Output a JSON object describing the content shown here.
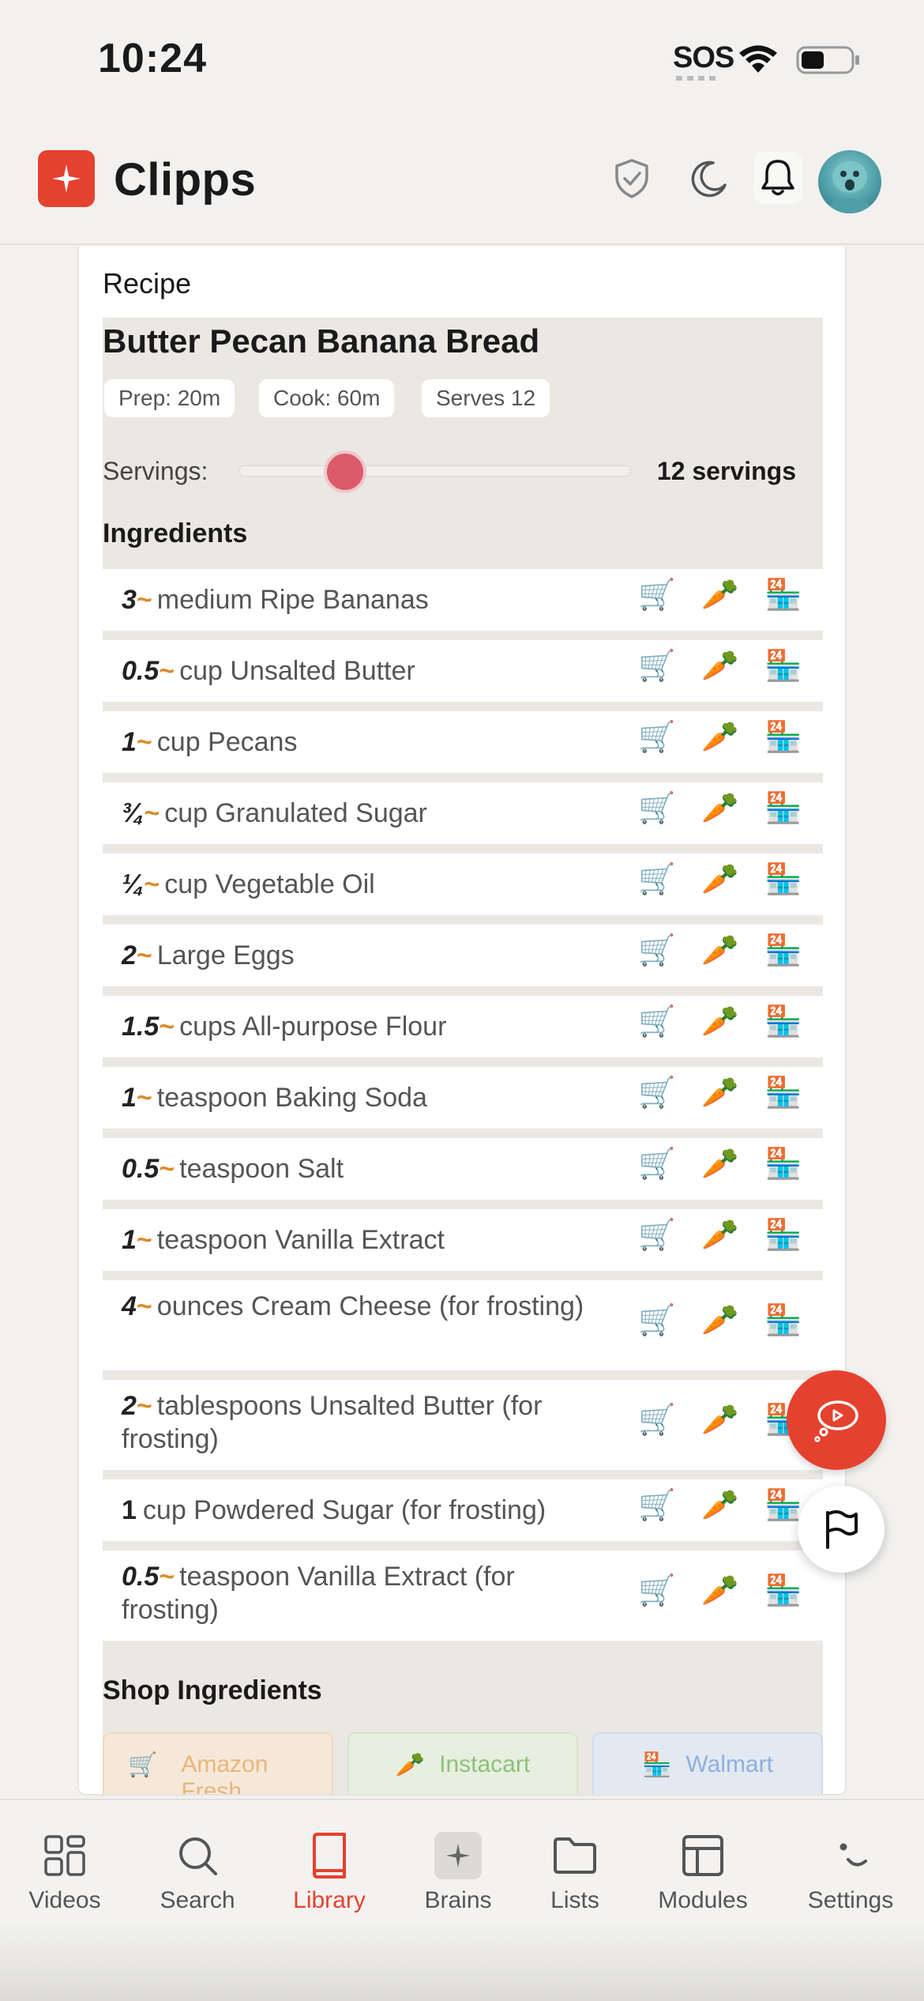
{
  "status_bar": {
    "time": "10:24",
    "sos": "SOS"
  },
  "header": {
    "app_name": "Clipps"
  },
  "recipe": {
    "section_label": "Recipe",
    "title": "Butter Pecan Banana Bread",
    "chips": {
      "prep": "Prep: 20m",
      "cook": "Cook: 60m",
      "serves": "Serves 12"
    },
    "servings_label": "Servings:",
    "servings_value": "12 servings",
    "servings_slider_fraction": 0.27,
    "ingredients_heading": "Ingredients",
    "ingredients": [
      {
        "qty": "3",
        "approx": "~",
        "text": "medium Ripe Bananas"
      },
      {
        "qty": "0.5",
        "approx": "~",
        "text": "cup Unsalted Butter"
      },
      {
        "qty": "1",
        "approx": "~",
        "text": "cup Pecans"
      },
      {
        "qty": "¾",
        "approx": "~",
        "text": "cup Granulated Sugar"
      },
      {
        "qty": "¼",
        "approx": "~",
        "text": "cup Vegetable Oil"
      },
      {
        "qty": "2",
        "approx": "~",
        "text": "Large Eggs"
      },
      {
        "qty": "1.5",
        "approx": "~",
        "text": "cups All-purpose Flour"
      },
      {
        "qty": "1",
        "approx": "~",
        "text": "teaspoon Baking Soda"
      },
      {
        "qty": "0.5",
        "approx": "~",
        "text": "teaspoon Salt"
      },
      {
        "qty": "1",
        "approx": "~",
        "text": "teaspoon Vanilla Extract"
      },
      {
        "qty": "4",
        "approx": "~",
        "text": "ounces Cream Cheese (for frosting)"
      },
      {
        "qty": "2",
        "approx": "~",
        "text": "tablespoons Unsalted Butter (for frosting)"
      },
      {
        "qty": "1",
        "approx": "",
        "text": "cup Powdered Sugar (for frosting)"
      },
      {
        "qty": "0.5",
        "approx": "~",
        "text": "teaspoon Vanilla Extract (for frosting)"
      }
    ],
    "row_icons": {
      "cart": "🛒",
      "carrot": "🥕",
      "store": "🏪"
    },
    "shop": {
      "heading": "Shop Ingredients",
      "amazon": "Amazon Fresh",
      "instacart": "Instacart",
      "walmart": "Walmart"
    }
  },
  "nav": {
    "items": [
      {
        "label": "Videos",
        "icon": "grid-icon"
      },
      {
        "label": "Search",
        "icon": "search-icon"
      },
      {
        "label": "Library",
        "icon": "book-icon",
        "active": true
      },
      {
        "label": "Brains",
        "icon": "sparkle-icon"
      },
      {
        "label": "Lists",
        "icon": "folder-icon"
      },
      {
        "label": "Modules",
        "icon": "table-icon"
      },
      {
        "label": "Settings",
        "icon": "dots-icon"
      }
    ]
  },
  "colors": {
    "accent": "#e5412f",
    "slider": "#dc5b6b",
    "approx": "#d98c2a"
  }
}
